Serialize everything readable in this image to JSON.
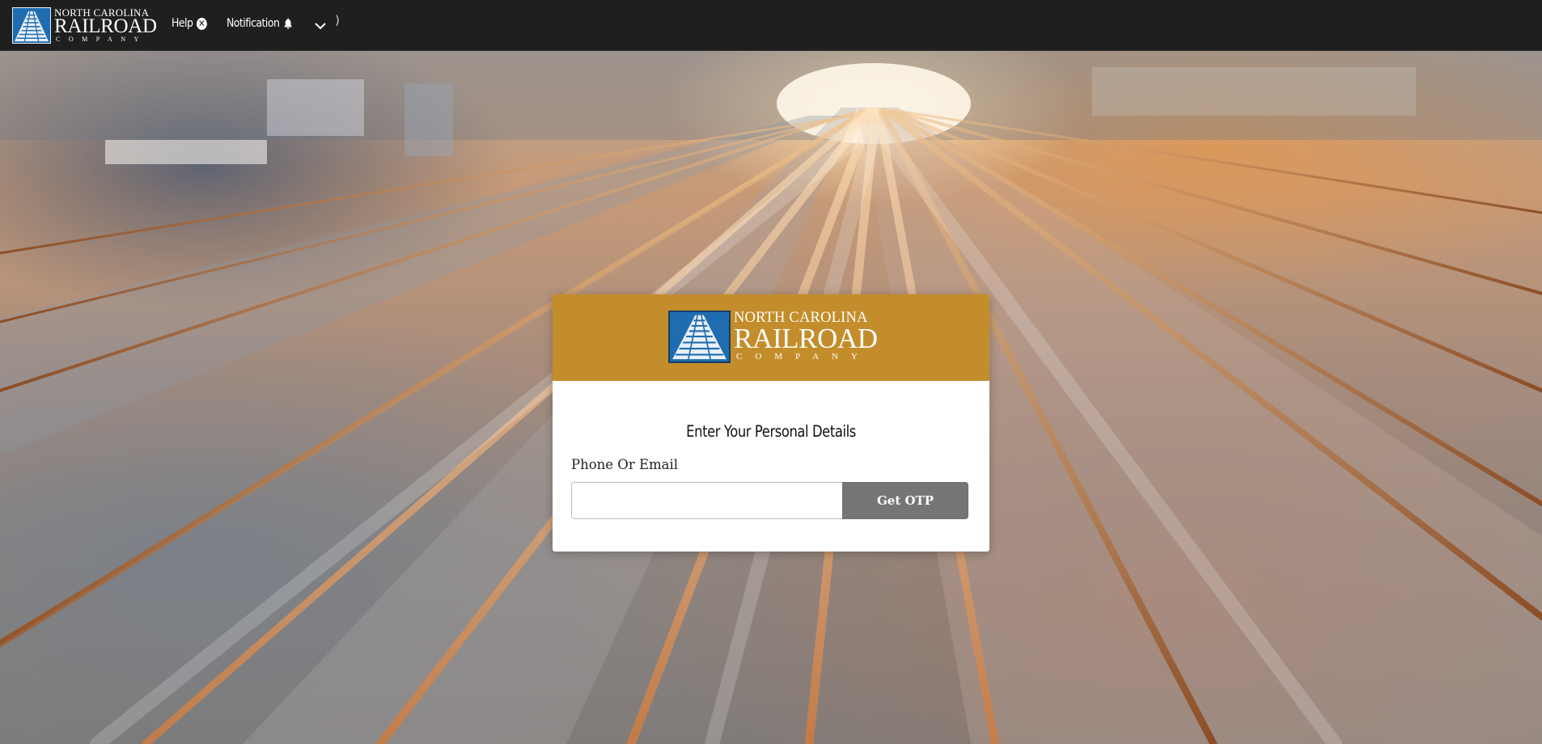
{
  "brand": {
    "line1": "NORTH CAROLINA",
    "line2": "RAILROAD",
    "line3": "COMPANY",
    "primary_color": "#c48d2b",
    "logo_blue": "#1f6db0"
  },
  "navbar": {
    "help_label": "Help",
    "help_icon": "circle-x-icon",
    "notification_label": "Notification",
    "notification_icon": "bell-icon",
    "dropdown_icon": "chevron-down-icon",
    "stray_glyph": ")",
    "background": "#1f1f1f"
  },
  "login": {
    "title": "Enter Your Personal Details",
    "field_label": "Phone Or Email",
    "input_value": "",
    "input_placeholder": "",
    "button_label": "Get OTP",
    "button_color": "#757575"
  }
}
